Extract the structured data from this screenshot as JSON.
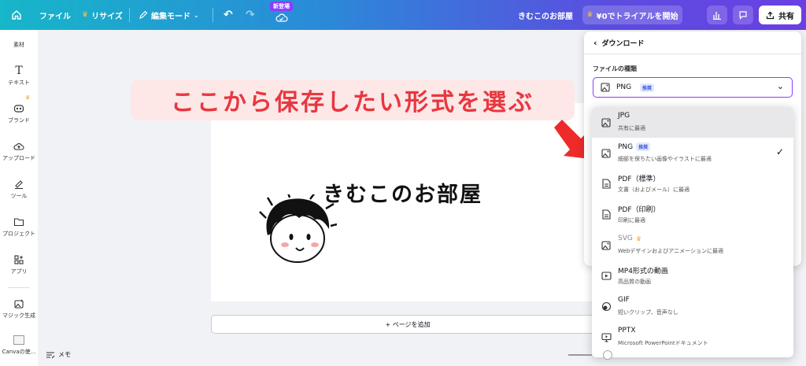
{
  "topbar": {
    "file": "ファイル",
    "resize": "リサイズ",
    "edit_mode": "編集モード",
    "new_badge": "新登場",
    "doc_title": "きむこのお部屋",
    "trial": "¥0でトライアルを開始",
    "share": "共有"
  },
  "sidebar": {
    "items": [
      {
        "label": "素材"
      },
      {
        "label": "テキスト"
      },
      {
        "label": "ブランド"
      },
      {
        "label": "アップロード"
      },
      {
        "label": "ツール"
      },
      {
        "label": "プロジェクト"
      },
      {
        "label": "アプリ"
      },
      {
        "label": "マジック生成"
      },
      {
        "label": "Canvaの使..."
      }
    ]
  },
  "canvas": {
    "heading": "きむこのお部屋",
    "add_page": "+ ページを追加"
  },
  "annotation": "ここから保存したい形式を選ぶ",
  "download": {
    "back_title": "ダウンロード",
    "file_type_label": "ファイルの種類",
    "selected": "PNG",
    "recommended": "推奨",
    "options": [
      {
        "name": "JPG",
        "desc": "共有に最適"
      },
      {
        "name": "PNG",
        "desc": "細部を保ちたい画像やイラストに最適",
        "badge": "推奨"
      },
      {
        "name": "PDF（標準）",
        "desc": "文書（およびメール）に最適"
      },
      {
        "name": "PDF（印刷）",
        "desc": "印刷に最適"
      },
      {
        "name": "SVG",
        "desc": "Webデザインおよびアニメーションに最適"
      },
      {
        "name": "MP4形式の動画",
        "desc": "高品質の動画"
      },
      {
        "name": "GIF",
        "desc": "短いクリップ、音声なし"
      },
      {
        "name": "PPTX",
        "desc": "Microsoft PowerPointドキュメント"
      }
    ]
  },
  "bottombar": {
    "memo": "メモ"
  }
}
